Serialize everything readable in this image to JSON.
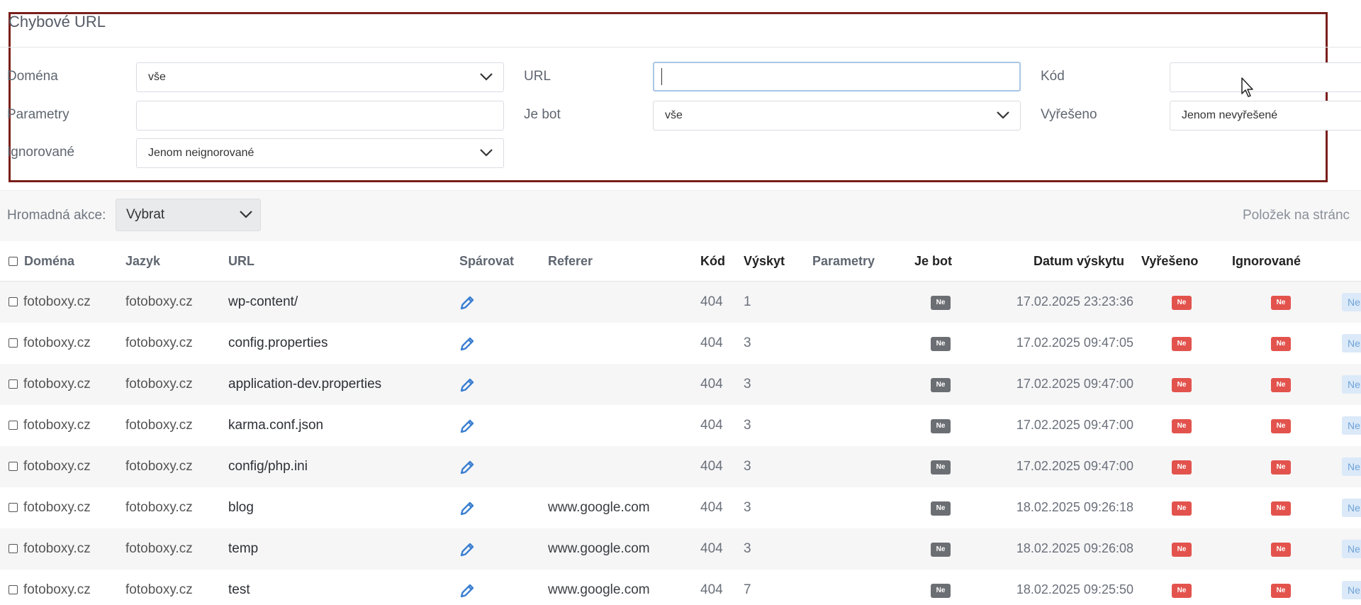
{
  "panel": {
    "title": "Chybové URL"
  },
  "filters": {
    "domena": {
      "label": "Doména",
      "value": "vše"
    },
    "url": {
      "label": "URL",
      "value": ""
    },
    "kod": {
      "label": "Kód",
      "value": ""
    },
    "parametry": {
      "label": "Parametry",
      "value": ""
    },
    "je_bot": {
      "label": "Je bot",
      "value": "vše"
    },
    "vyreseno": {
      "label": "Vyřešeno",
      "value": "Jenom nevyřešené"
    },
    "ignorovane": {
      "label": "Ignorované",
      "value": "Jenom neignorované"
    }
  },
  "bulk": {
    "label": "Hromadná akce:",
    "value": "Vybrat",
    "per_page_label": "Položek na stránc"
  },
  "table": {
    "headers": {
      "domena": "Doména",
      "jazyk": "Jazyk",
      "url": "URL",
      "sparovat": "Spárovat",
      "referer": "Referer",
      "kod": "Kód",
      "vyskyt": "Výskyt",
      "parametry": "Parametry",
      "je_bot": "Je bot",
      "datum": "Datum výskytu",
      "vyreseno": "Vyřešeno",
      "ignorovane": "Ignorované"
    },
    "rows": [
      {
        "domena": "fotoboxy.cz",
        "jazyk": "fotoboxy.cz",
        "url": "wp-content/",
        "referer": "",
        "kod": "404",
        "vyskyt": "1",
        "je_bot": "Ne",
        "datum": "17.02.2025 23:23:36",
        "vyreseno": "Ne",
        "ignorovane": "Ne",
        "extra": "Ne"
      },
      {
        "domena": "fotoboxy.cz",
        "jazyk": "fotoboxy.cz",
        "url": "config.properties",
        "referer": "",
        "kod": "404",
        "vyskyt": "3",
        "je_bot": "Ne",
        "datum": "17.02.2025 09:47:05",
        "vyreseno": "Ne",
        "ignorovane": "Ne",
        "extra": "Ne"
      },
      {
        "domena": "fotoboxy.cz",
        "jazyk": "fotoboxy.cz",
        "url": "application-dev.properties",
        "referer": "",
        "kod": "404",
        "vyskyt": "3",
        "je_bot": "Ne",
        "datum": "17.02.2025 09:47:00",
        "vyreseno": "Ne",
        "ignorovane": "Ne",
        "extra": "Ne"
      },
      {
        "domena": "fotoboxy.cz",
        "jazyk": "fotoboxy.cz",
        "url": "karma.conf.json",
        "referer": "",
        "kod": "404",
        "vyskyt": "3",
        "je_bot": "Ne",
        "datum": "17.02.2025 09:47:00",
        "vyreseno": "Ne",
        "ignorovane": "Ne",
        "extra": "Ne"
      },
      {
        "domena": "fotoboxy.cz",
        "jazyk": "fotoboxy.cz",
        "url": "config/php.ini",
        "referer": "",
        "kod": "404",
        "vyskyt": "3",
        "je_bot": "Ne",
        "datum": "17.02.2025 09:47:00",
        "vyreseno": "Ne",
        "ignorovane": "Ne",
        "extra": "Ne"
      },
      {
        "domena": "fotoboxy.cz",
        "jazyk": "fotoboxy.cz",
        "url": "blog",
        "referer": "www.google.com",
        "kod": "404",
        "vyskyt": "3",
        "je_bot": "Ne",
        "datum": "18.02.2025 09:26:18",
        "vyreseno": "Ne",
        "ignorovane": "Ne",
        "extra": "Ne"
      },
      {
        "domena": "fotoboxy.cz",
        "jazyk": "fotoboxy.cz",
        "url": "temp",
        "referer": "www.google.com",
        "kod": "404",
        "vyskyt": "3",
        "je_bot": "Ne",
        "datum": "18.02.2025 09:26:08",
        "vyreseno": "Ne",
        "ignorovane": "Ne",
        "extra": "Ne"
      },
      {
        "domena": "fotoboxy.cz",
        "jazyk": "fotoboxy.cz",
        "url": "test",
        "referer": "www.google.com",
        "kod": "404",
        "vyskyt": "7",
        "je_bot": "Ne",
        "datum": "18.02.2025 09:25:50",
        "vyreseno": "Ne",
        "ignorovane": "Ne",
        "extra": "Ne"
      }
    ]
  },
  "icons": {
    "select_chevron": "chevron-down-icon",
    "edit": "pencil-icon",
    "cursor": "mouse-cursor-icon"
  },
  "colors": {
    "highlight_border": "#7a1f1a",
    "badge_gray": "#6b6e73",
    "badge_red": "#e3534d",
    "edit_icon": "#3b7fd1",
    "focus_border": "#a9c6e6"
  }
}
